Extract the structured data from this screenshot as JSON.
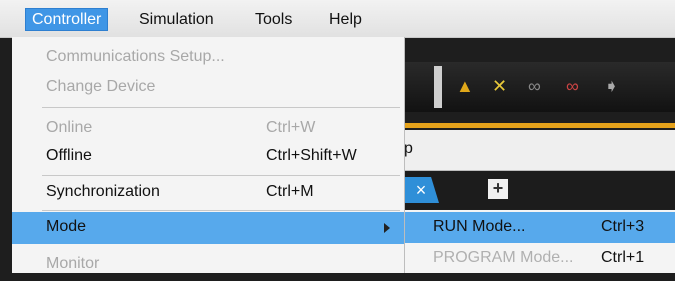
{
  "menubar": {
    "items": [
      {
        "label": "Controller"
      },
      {
        "label": "Simulation"
      },
      {
        "label": "Tools"
      },
      {
        "label": "Help"
      }
    ]
  },
  "background": {
    "panel_text": "p"
  },
  "menu": {
    "items": [
      {
        "label": "Communications Setup...",
        "shortcut": "",
        "enabled": false
      },
      {
        "label": "Change Device",
        "shortcut": "",
        "enabled": false
      },
      {
        "label": "Online",
        "shortcut": "Ctrl+W",
        "enabled": false
      },
      {
        "label": "Offline",
        "shortcut": "Ctrl+Shift+W",
        "enabled": true
      },
      {
        "label": "Synchronization",
        "shortcut": "Ctrl+M",
        "enabled": true
      },
      {
        "label": "Mode",
        "shortcut": "",
        "enabled": true,
        "highlighted": true
      },
      {
        "label": "Monitor",
        "shortcut": "",
        "enabled": false
      }
    ]
  },
  "submenu": {
    "items": [
      {
        "label": "RUN Mode...",
        "shortcut": "Ctrl+3",
        "enabled": true,
        "highlighted": true
      },
      {
        "label": "PROGRAM Mode...",
        "shortcut": "Ctrl+1",
        "enabled": false
      }
    ]
  },
  "colors": {
    "highlight": "#57a9ec",
    "active_menu": "#3f96e6",
    "accent_bar": "#e5a21b"
  }
}
